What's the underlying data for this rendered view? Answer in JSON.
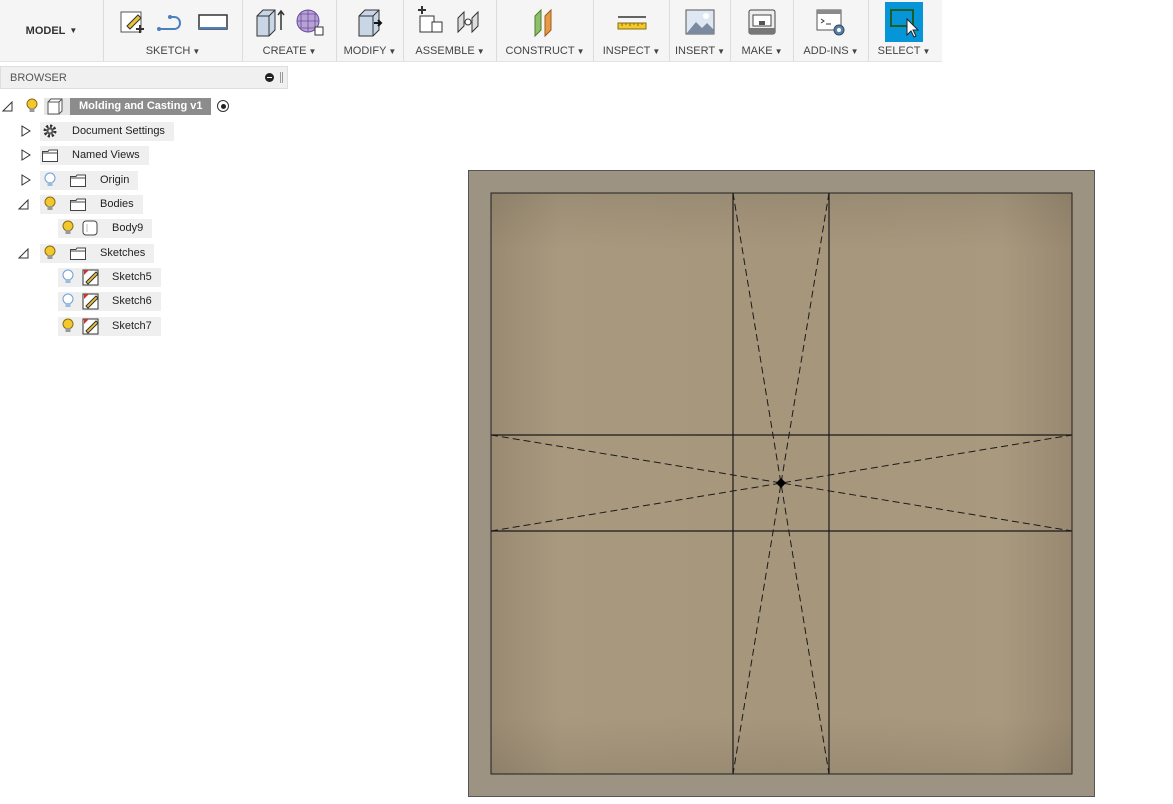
{
  "toolbar": {
    "workspace": "MODEL",
    "groups": [
      {
        "label": "SKETCH"
      },
      {
        "label": "CREATE"
      },
      {
        "label": "MODIFY"
      },
      {
        "label": "ASSEMBLE"
      },
      {
        "label": "CONSTRUCT"
      },
      {
        "label": "INSPECT"
      },
      {
        "label": "INSERT"
      },
      {
        "label": "MAKE"
      },
      {
        "label": "ADD-INS"
      },
      {
        "label": "SELECT"
      }
    ]
  },
  "browser": {
    "title": "BROWSER",
    "root": {
      "label": "Molding and Casting v1"
    },
    "items": [
      {
        "label": "Document Settings"
      },
      {
        "label": "Named Views"
      },
      {
        "label": "Origin"
      },
      {
        "label": "Bodies"
      },
      {
        "label": "Body9"
      },
      {
        "label": "Sketches"
      },
      {
        "label": "Sketch5"
      },
      {
        "label": "Sketch6"
      },
      {
        "label": "Sketch7"
      }
    ]
  },
  "colors": {
    "accent": "#0696d7",
    "mold_frame": "#9c9382",
    "mold_inner": "#a6977e",
    "bulb_on": "#f2c82e",
    "bulb_off": "#6a9fd6"
  }
}
